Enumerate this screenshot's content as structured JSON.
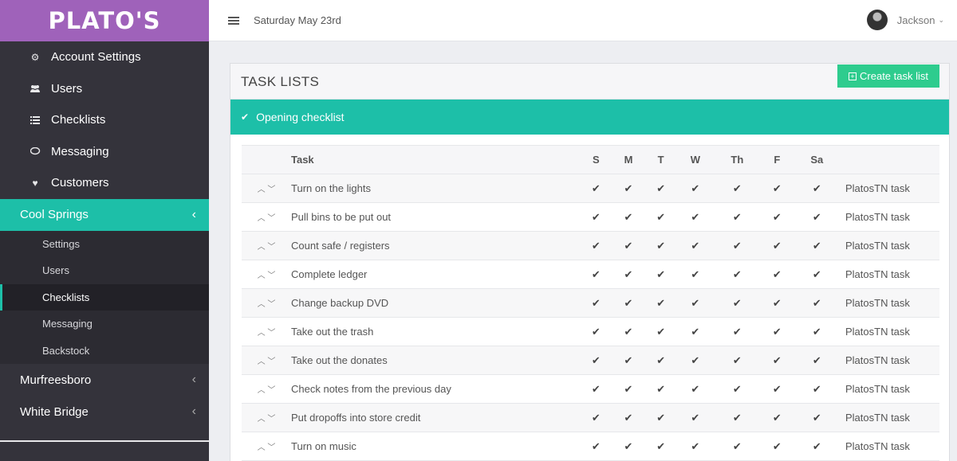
{
  "sidebar": {
    "logo": "PLATO'S",
    "nav": [
      {
        "icon": "gears-icon",
        "label": "Account Settings"
      },
      {
        "icon": "users-icon",
        "label": "Users"
      },
      {
        "icon": "list-icon",
        "label": "Checklists"
      },
      {
        "icon": "chat-icon",
        "label": "Messaging"
      },
      {
        "icon": "heart-icon",
        "label": "Customers"
      }
    ],
    "groups": [
      {
        "label": "Cool Springs",
        "active": true
      },
      {
        "label": "Murfreesboro"
      },
      {
        "label": "White Bridge"
      }
    ],
    "sub_items": [
      "Settings",
      "Users",
      "Checklists",
      "Messaging",
      "Backstock"
    ],
    "active_sub": "Checklists",
    "accent": "#1dbfa8",
    "brand": "#9f62ba"
  },
  "topbar": {
    "date": "Saturday May 23rd",
    "user_name": "Jackson"
  },
  "panel": {
    "title": "TASK LISTS",
    "create_button": "Create task list",
    "checklist_title": "Opening checklist"
  },
  "table": {
    "headers": {
      "task": "Task",
      "days": [
        "S",
        "M",
        "T",
        "W",
        "Th",
        "F",
        "Sa"
      ]
    },
    "rows": [
      {
        "task": "Turn on the lights",
        "tag": "PlatosTN task"
      },
      {
        "task": "Pull bins to be put out",
        "tag": "PlatosTN task"
      },
      {
        "task": "Count safe / registers",
        "tag": "PlatosTN task"
      },
      {
        "task": "Complete ledger",
        "tag": "PlatosTN task"
      },
      {
        "task": "Change backup DVD",
        "tag": "PlatosTN task"
      },
      {
        "task": "Take out the trash",
        "tag": "PlatosTN task"
      },
      {
        "task": "Take out the donates",
        "tag": "PlatosTN task"
      },
      {
        "task": "Check notes from the previous day",
        "tag": "PlatosTN task"
      },
      {
        "task": "Put dropoffs into store credit",
        "tag": "PlatosTN task"
      },
      {
        "task": "Turn on music",
        "tag": "PlatosTN task"
      }
    ]
  }
}
